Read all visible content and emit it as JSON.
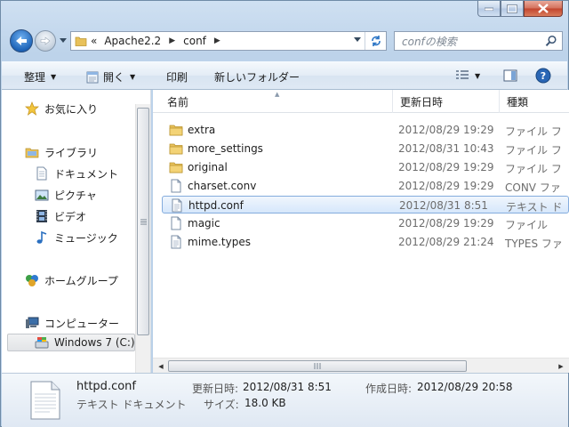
{
  "window": {
    "caption_buttons": [
      "minimize",
      "maximize",
      "close"
    ]
  },
  "address": {
    "overflow": "«",
    "crumbs": [
      "Apache2.2",
      "conf"
    ],
    "search_placeholder": "confの検索"
  },
  "toolbar": {
    "organize": "整理",
    "open": "開く",
    "print": "印刷",
    "new_folder": "新しいフォルダー"
  },
  "nav": {
    "favorites": "お気に入り",
    "libraries": "ライブラリ",
    "documents": "ドキュメント",
    "pictures": "ピクチャ",
    "videos": "ビデオ",
    "music": "ミュージック",
    "homegroup": "ホームグループ",
    "computer": "コンピューター",
    "drive": "Windows 7 (C:)"
  },
  "columns": {
    "name": "名前",
    "modified": "更新日時",
    "type": "種類"
  },
  "files": [
    {
      "name": "extra",
      "date": "2012/08/29 19:29",
      "type": "ファイル フ",
      "icon": "folder-icon"
    },
    {
      "name": "more_settings",
      "date": "2012/08/31 10:43",
      "type": "ファイル フ",
      "icon": "folder-icon"
    },
    {
      "name": "original",
      "date": "2012/08/29 19:29",
      "type": "ファイル フ",
      "icon": "folder-icon"
    },
    {
      "name": "charset.conv",
      "date": "2012/08/29 19:29",
      "type": "CONV ファ",
      "icon": "file-icon"
    },
    {
      "name": "httpd.conf",
      "date": "2012/08/31 8:51",
      "type": "テキスト ド",
      "icon": "text-file-icon"
    },
    {
      "name": "magic",
      "date": "2012/08/29 19:29",
      "type": "ファイル",
      "icon": "file-icon"
    },
    {
      "name": "mime.types",
      "date": "2012/08/29 21:24",
      "type": "TYPES ファ",
      "icon": "text-file-icon"
    }
  ],
  "selected_index": 4,
  "details": {
    "name": "httpd.conf",
    "type": "テキスト ドキュメント",
    "modified_label": "更新日時:",
    "modified_value": "2012/08/31 8:51",
    "created_label": "作成日時:",
    "created_value": "2012/08/29 20:58",
    "size_label": "サイズ:",
    "size_value": "18.0 KB"
  },
  "colors": {
    "frame": "#bdd3ea",
    "selection": "#d6e7fb",
    "selection_border": "#84acdd",
    "folder": "#e8c15a"
  }
}
